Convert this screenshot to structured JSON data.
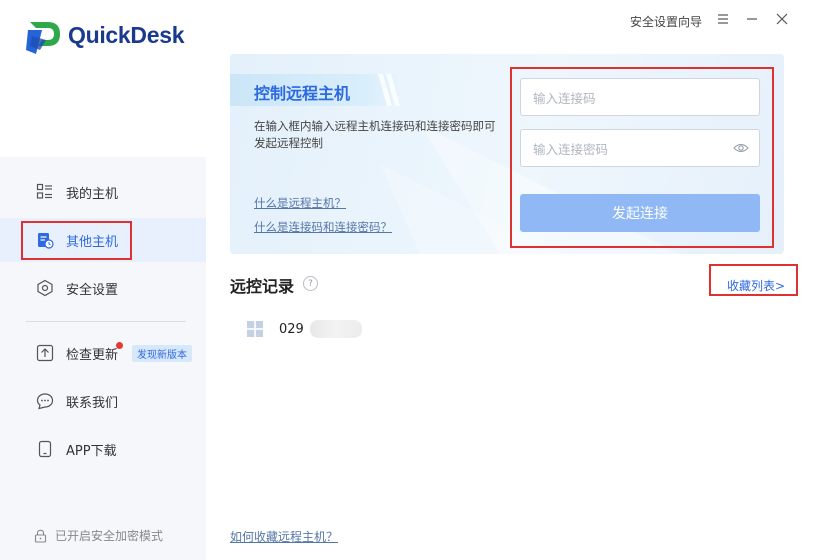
{
  "app": {
    "name": "QuickDesk",
    "brand_color": "#1a3a8f",
    "accent_color": "#2d6ae0"
  },
  "titlebar": {
    "wizard_label": "安全设置向导",
    "menu_icon": "menu-icon",
    "minimize_icon": "minimize-icon",
    "close_icon": "close-icon"
  },
  "sidebar": {
    "items": [
      {
        "label": "我的主机",
        "icon": "hosts-icon"
      },
      {
        "label": "其他主机",
        "icon": "other-hosts-icon",
        "active": true
      },
      {
        "label": "安全设置",
        "icon": "shield-icon"
      },
      {
        "label": "检查更新",
        "icon": "update-icon",
        "badge": "发现新版本"
      },
      {
        "label": "联系我们",
        "icon": "chat-icon"
      },
      {
        "label": "APP下载",
        "icon": "phone-icon"
      }
    ],
    "footer": "已开启安全加密模式"
  },
  "banner": {
    "title": "控制远程主机",
    "description": "在输入框内输入远程主机连接码和连接密码即可发起远程控制",
    "link1": "什么是远程主机？",
    "link2": "什么是连接码和连接密码？",
    "code_placeholder": "输入连接码",
    "password_placeholder": "输入连接密码",
    "connect_label": "发起连接"
  },
  "records": {
    "title": "远控记录",
    "help": "?",
    "favorites_link": "收藏列表>",
    "items": [
      {
        "name": "029"
      }
    ]
  },
  "bottom_link": "如何收藏远程主机？"
}
